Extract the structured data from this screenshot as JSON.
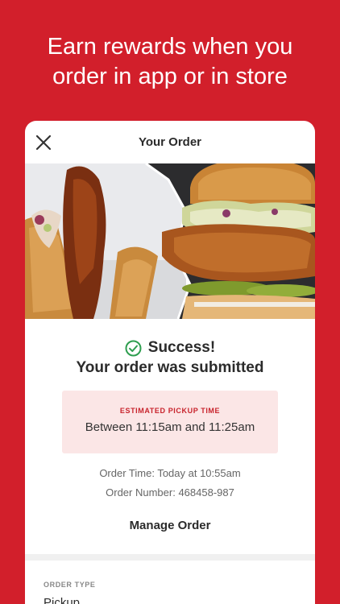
{
  "promo": {
    "line1": "Earn rewards when you",
    "line2": "order in app or in store"
  },
  "nav": {
    "title": "Your Order",
    "close_icon": "close-icon"
  },
  "confirmation": {
    "status": "Success!",
    "message": "Your order was submitted",
    "status_icon": "check-circle-icon"
  },
  "pickup": {
    "label": "ESTIMATED PICKUP TIME",
    "window": "Between 11:15am and 11:25am"
  },
  "order": {
    "time": "Order Time: Today at 10:55am",
    "number": "Order Number: 468458-987",
    "manage_label": "Manage Order",
    "type_label": "ORDER TYPE",
    "type_value": "Pickup"
  },
  "colors": {
    "brand": "#d21f2b",
    "success": "#2e9e4f",
    "pickup_bg": "#fbe6e6"
  }
}
